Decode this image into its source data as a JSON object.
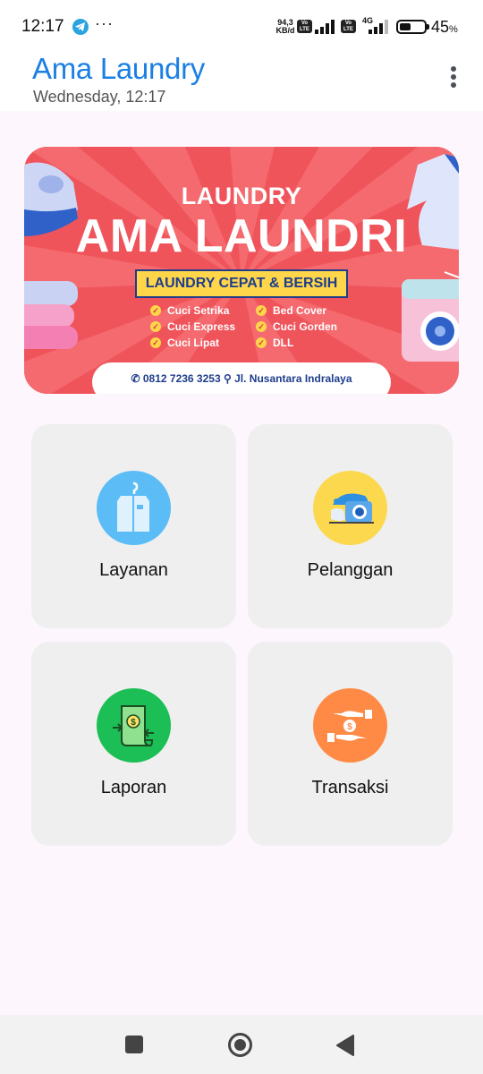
{
  "status_bar": {
    "time": "12:17",
    "more": "···",
    "net_speed_value": "94,3",
    "net_speed_unit": "KB/d",
    "volte_label": "Vo LTE",
    "network": "4G",
    "battery_level": 0.45,
    "battery_percent": "45",
    "battery_unit": "%",
    "icons": [
      "telegram-icon",
      "signal-icon",
      "battery-icon"
    ]
  },
  "app_bar": {
    "title": "Ama Laundry",
    "subtitle": "Wednesday, 12:17",
    "menu_icon": "more-vert-icon"
  },
  "banner": {
    "kicker": "LAUNDRY",
    "title": "AMA LAUNDRI",
    "tagline": "LAUNDRY CEPAT & BERSIH",
    "services_left": [
      "Cuci Setrika",
      "Cuci Express",
      "Cuci Lipat"
    ],
    "services_right": [
      "Bed Cover",
      "Cuci Gorden",
      "DLL"
    ],
    "phone": "0812 7236 3253",
    "address": "Jl. Nusantara Indralaya",
    "colors": {
      "background": "#f0545b",
      "ribbon": "#ffd64a",
      "ink": "#1f3d8c"
    }
  },
  "menu": [
    {
      "label": "Layanan",
      "icon": "garment-bag-icon",
      "color": "#5cbcf6"
    },
    {
      "label": "Pelanggan",
      "icon": "washing-machine-icon",
      "color": "#fcd84e"
    },
    {
      "label": "Laporan",
      "icon": "money-scroll-icon",
      "color": "#1bbf55"
    },
    {
      "label": "Transaksi",
      "icon": "hand-money-icon",
      "color": "#ff8a45"
    }
  ],
  "nav_bar": {
    "icons": [
      "recents-icon",
      "home-icon",
      "back-icon"
    ]
  },
  "colors": {
    "accent": "#1b7fe3",
    "page_bg": "#fdf6fd",
    "card_bg": "#efefef"
  }
}
